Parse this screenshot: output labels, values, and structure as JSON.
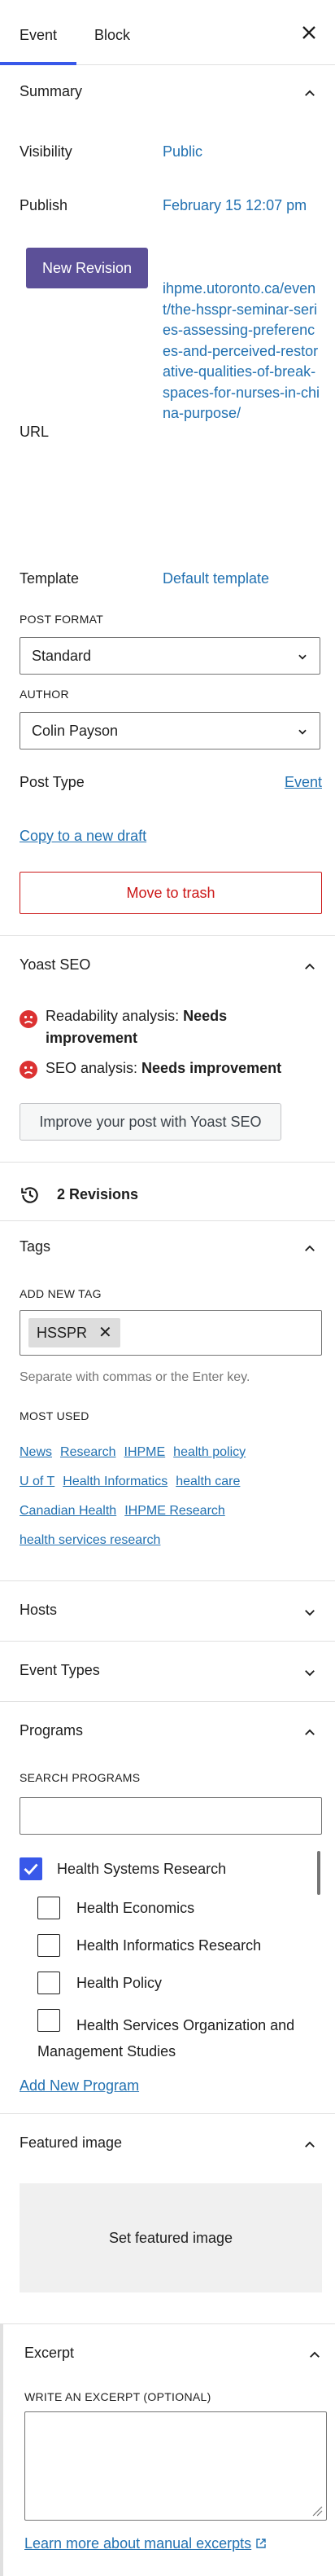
{
  "tabs": {
    "event": "Event",
    "block": "Block"
  },
  "summary": {
    "title": "Summary",
    "visibility_label": "Visibility",
    "visibility_value": "Public",
    "publish_label": "Publish",
    "publish_value": "February 15 12:07 pm",
    "new_revision_button": "New Revision",
    "url_label": "URL",
    "url_value": "ihpme.utoronto.ca/event/the-hsspr-seminar-series-assessing-preferences-and-perceived-restorative-qualities-of-break-spaces-for-nurses-in-china-purpose/",
    "template_label": "Template",
    "template_value": "Default template",
    "post_format_label": "POST FORMAT",
    "post_format_value": "Standard",
    "author_label": "AUTHOR",
    "author_value": "Colin Payson",
    "post_type_label": "Post Type",
    "post_type_value": "Event",
    "copy_draft": "Copy to a new draft",
    "move_trash": "Move to trash"
  },
  "yoast": {
    "title": "Yoast SEO",
    "readability_prefix": "Readability analysis: ",
    "readability_status": "Needs improvement",
    "seo_prefix": "SEO analysis: ",
    "seo_status": "Needs improvement",
    "improve_button": "Improve your post with Yoast SEO"
  },
  "revisions": {
    "label": "2 Revisions"
  },
  "tags": {
    "title": "Tags",
    "add_new_label": "ADD NEW TAG",
    "current_tag": "HSSPR",
    "help": "Separate with commas or the Enter key.",
    "most_used_label": "MOST USED",
    "most_used": [
      "News",
      "Research",
      "IHPME",
      "health policy",
      "U of T",
      "Health Informatics",
      "health care",
      "Canadian Health",
      "IHPME Research",
      "health services research"
    ]
  },
  "hosts": {
    "title": "Hosts"
  },
  "event_types": {
    "title": "Event Types"
  },
  "programs": {
    "title": "Programs",
    "search_label": "SEARCH PROGRAMS",
    "items": [
      {
        "label": "Health Systems Research",
        "checked": true
      },
      {
        "label": "Health Economics",
        "checked": false
      },
      {
        "label": "Health Informatics Research",
        "checked": false
      },
      {
        "label": "Health Policy",
        "checked": false
      },
      {
        "label": "Health Services Organization and Management Studies",
        "checked": false
      }
    ],
    "add_new": "Add New Program"
  },
  "featured_image": {
    "title": "Featured image",
    "button": "Set featured image"
  },
  "excerpt": {
    "title": "Excerpt",
    "field_label": "WRITE AN EXCERPT (OPTIONAL)",
    "learn_more": "Learn more about manual excerpts"
  },
  "colors": {
    "accent": "#3858e9",
    "link": "#2271b1",
    "primary_button": "#5c5098",
    "danger": "#cc1818"
  }
}
